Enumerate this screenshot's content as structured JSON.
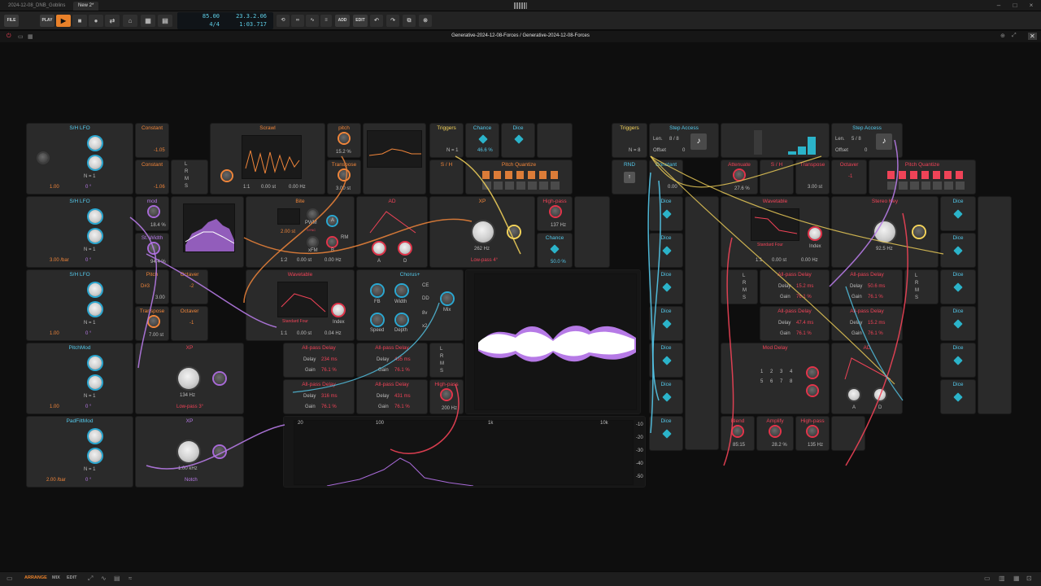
{
  "titlebar": {
    "tab1": "2024-12-08_DNB_Goblins",
    "tab2": "New 2*",
    "logo_label": "bitwig",
    "win_min": "–",
    "win_max": "□",
    "win_close": "×"
  },
  "toolbar": {
    "file_label": "FILE",
    "play_label": "PLAY",
    "add_label": "ADD",
    "edit_label": "EDIT",
    "transport": {
      "tempo": "85.00",
      "time_signature": "4/4",
      "position": "23.3.2.06",
      "time": "1:03.717"
    }
  },
  "editor": {
    "title": "Generative-2024-12-08-Forces / Generative-2024-12-08-Forces"
  },
  "modules": {
    "sh_lfo_1": {
      "title": "S/H LFO",
      "rate": "1.00",
      "phase": "0 °",
      "n": "N = 1"
    },
    "sh_lfo_2": {
      "title": "S/H LFO",
      "rate": "3.00 /bar",
      "phase": "0 °",
      "n": "N = 1"
    },
    "sh_lfo_3": {
      "title": "S/H LFO",
      "rate": "1.00",
      "phase": "0 °",
      "n": "N = 1"
    },
    "pitchmod": {
      "title": "PitchMod",
      "rate": "1.00",
      "phase": "0 °",
      "n": "N = 1"
    },
    "padfiltmod": {
      "title": "PadFiltMod",
      "rate": "2.00 /bar",
      "phase": "0 °",
      "n": "N = 1"
    },
    "constant_1": {
      "title": "Constant",
      "value": "-1.05"
    },
    "constant_2": {
      "title": "Constant",
      "value": "-1.06"
    },
    "mod": {
      "title": "mod",
      "value": "18.4 %"
    },
    "st_width": {
      "title": "St. Width",
      "value": "94.4 %"
    },
    "pitch_1": {
      "title": "Pitch",
      "note": "D#3",
      "value": "3.00"
    },
    "octaver_1": {
      "title": "Octaver",
      "value": "-2"
    },
    "transpose_1": {
      "title": "Transpose",
      "value": "7.00 st"
    },
    "octaver_2": {
      "title": "Octaver",
      "value": "-1"
    },
    "scrawl": {
      "title": "Scrawl",
      "ratio": "1:1",
      "st": "0.00 st",
      "hz": "0.00 Hz"
    },
    "pitch_2": {
      "title": "pitch",
      "value": "15.2 %"
    },
    "transpose_2": {
      "title": "Transpose",
      "value": "3.00 st"
    },
    "triggers_1": {
      "title": "Triggers",
      "n": "N = 1"
    },
    "chance_1": {
      "title": "Chance",
      "value": "46.6 %"
    },
    "dice_1": {
      "title": "Dice"
    },
    "sh": {
      "title": "S / H"
    },
    "pitch_quantize_1": {
      "title": "Pitch Quantize"
    },
    "bite": {
      "title": "Bite",
      "st": "2.00 st",
      "ratio": "1:2",
      "st2": "0.00 st",
      "hz": "0.00 Hz",
      "pwm": "PWM",
      "xfm": "xFM",
      "rm": "RM",
      "a": "A",
      "b": "B",
      "sync": "SYNC"
    },
    "ad_1": {
      "title": "AD",
      "a": "A",
      "d": "D"
    },
    "filter_1": {
      "title": "XP",
      "freq": "262 Hz",
      "mode": "Low-pass 4°"
    },
    "highpass_1": {
      "title": "High-pass",
      "value": "137 Hz"
    },
    "chance_2": {
      "title": "Chance",
      "value": "50.0 %"
    },
    "wavetable_1": {
      "title": "Wavetable",
      "table": "Standard Four",
      "index": "Index",
      "ratio": "1:1",
      "st": "0.00 st",
      "hz": "0.04 Hz"
    },
    "chorus": {
      "title": "Chorus+",
      "fb": "FB",
      "width": "Width",
      "speed": "Speed",
      "depth": "Depth",
      "mix": "Mix",
      "ce": "CE",
      "dd": "DD",
      "v8": "8v",
      "x2": "x2"
    },
    "xp_1": {
      "title": "XP",
      "freq": "134 Hz",
      "mode": "Low-pass 3°"
    },
    "xp_2": {
      "title": "XP",
      "freq": "1.00 kHz",
      "mode": "Notch"
    },
    "apd_1": {
      "title": "All-pass Delay",
      "delay": "234 ms",
      "gain": "76.1 %"
    },
    "apd_2": {
      "title": "All-pass Delay",
      "delay": "435 ms",
      "gain": "76.1 %"
    },
    "apd_3": {
      "title": "All-pass Delay",
      "delay": "316 ms",
      "gain": "76.1 %"
    },
    "apd_4": {
      "title": "All-pass Delay",
      "delay": "431 ms",
      "gain": "76.1 %"
    },
    "highpass_2": {
      "title": "High-pass",
      "value": "200 Hz"
    },
    "spectrum": {
      "ticks_x": [
        "20",
        "100",
        "1k",
        "10k"
      ],
      "ticks_y": [
        "-10",
        "-20",
        "-30",
        "-40",
        "-50"
      ]
    },
    "triggers_2": {
      "title": "Triggers",
      "n": "N = 8"
    },
    "step_access_1": {
      "title": "Step Access",
      "len": "Len.",
      "len_val": "8 / 8",
      "offset": "Offset",
      "offset_val": "0"
    },
    "step_access_2": {
      "title": "Step Access",
      "len": "Len.",
      "len_val": "5 / 8",
      "offset": "Offset",
      "offset_val": "0"
    },
    "rnd": {
      "title": "RND"
    },
    "constant_3": {
      "title": "Constant",
      "value": "0.00"
    },
    "attenuate": {
      "title": "Attenuate",
      "value": "27.6 %"
    },
    "sh_2": {
      "title": "S / H"
    },
    "transpose_3": {
      "title": "Transpose",
      "value": "3.00 st"
    },
    "octaver_3": {
      "title": "Octaver",
      "value": "-1"
    },
    "pitch_quantize_2": {
      "title": "Pitch Quantize"
    },
    "dice_right": {
      "title": "Dice"
    },
    "wavetable_2": {
      "title": "Wavetable",
      "table": "Standard Four",
      "index": "Index",
      "ratio": "1:1",
      "st": "0.00 st",
      "hz": "0.00 Hz"
    },
    "sidechain": {
      "title": "Stereo Key",
      "freq": "92.5 Hz"
    },
    "apd_5": {
      "title": "All-pass Delay",
      "delay": "15.2 ms",
      "gain": "76.1 %"
    },
    "apd_6": {
      "title": "All-pass Delay",
      "delay": "50.6 ms",
      "gain": "76.1 %"
    },
    "apd_7": {
      "title": "All-pass Delay",
      "delay": "47.4 ms",
      "gain": "76.1 %"
    },
    "apd_8": {
      "title": "All-pass Delay",
      "delay": "15.2 ms",
      "gain": "76.1 %"
    },
    "mod_delay": {
      "title": "Mod Delay",
      "steps": [
        "1",
        "2",
        "3",
        "4",
        "5",
        "6",
        "7",
        "8"
      ]
    },
    "ad_2": {
      "title": "AD",
      "a": "A",
      "d": "D"
    },
    "blend": {
      "title": "Blend",
      "value": "85:15"
    },
    "amplify": {
      "title": "Amplify",
      "value": "28.2 %"
    },
    "highpass_3": {
      "title": "High-pass",
      "value": "135 Hz"
    },
    "lrms": [
      "L",
      "R",
      "M",
      "S"
    ]
  },
  "statusbar": {
    "arrange": "ARRANGE",
    "mix": "MIX",
    "edit": "EDIT"
  },
  "colors": {
    "cyan": "#54c8ea",
    "orange": "#f0853a",
    "yellow": "#f4d35a",
    "red": "#ef4357",
    "purple": "#b67ae6",
    "play": "#e9812a"
  }
}
